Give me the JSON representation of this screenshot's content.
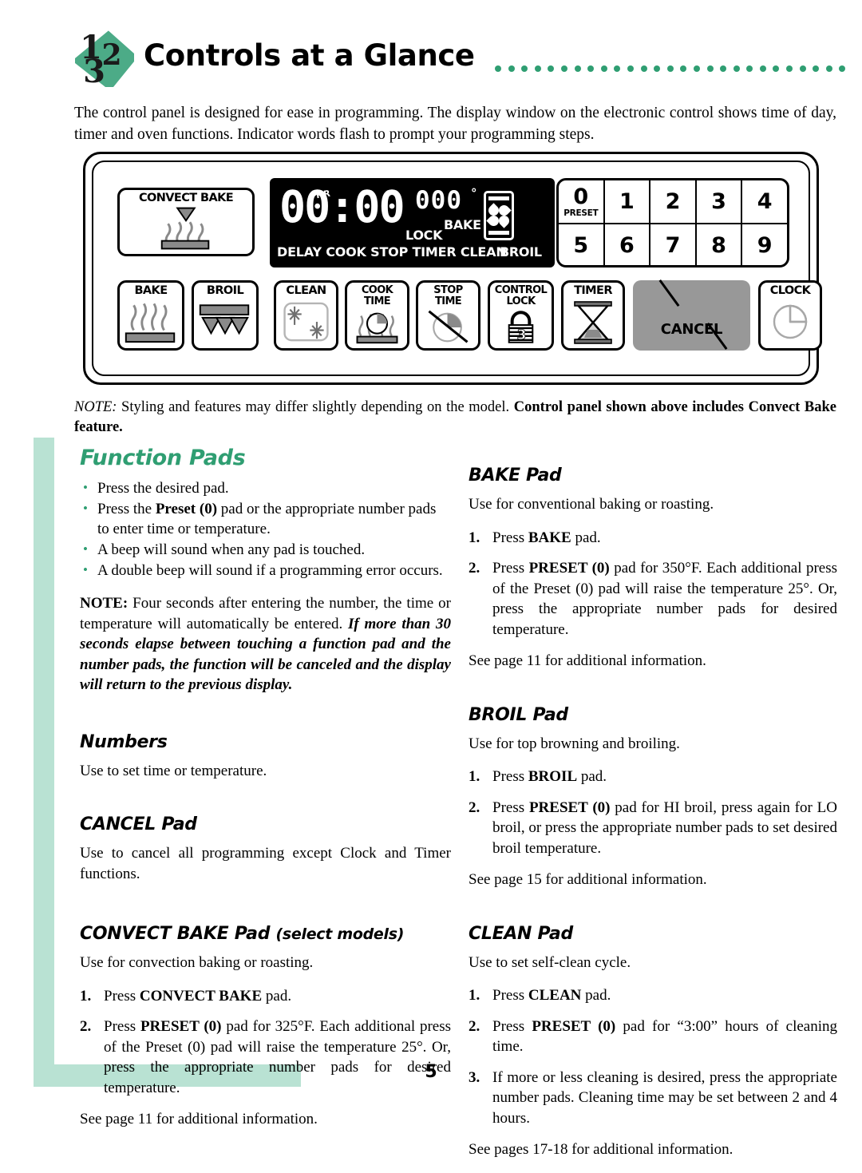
{
  "header": {
    "logo_numbers": [
      "1",
      "2",
      "3"
    ],
    "title": "Controls at a Glance",
    "dot_count": 27
  },
  "intro": "The control panel is designed for ease in programming. The display window on the electronic control shows time of day, timer and oven functions. Indicator words flash to prompt your programming steps.",
  "control_panel": {
    "convect_bake_pad": "CONVECT BAKE",
    "display": {
      "time": "00:00",
      "hr_indicator": "HR",
      "temperature": "000",
      "degree_symbol": "°",
      "lock_indicator": "LOCK",
      "bake_indicator": "BAKE",
      "broil_indicator": "BROIL",
      "status_words": "DELAY COOK STOP TIMER CLEAN",
      "fan_icon": "convection-fan-icon"
    },
    "keypad": {
      "row1": [
        {
          "num": "0",
          "sub": "PRESET"
        },
        {
          "num": "1",
          "sub": ""
        },
        {
          "num": "2",
          "sub": ""
        },
        {
          "num": "3",
          "sub": ""
        },
        {
          "num": "4",
          "sub": ""
        }
      ],
      "row2": [
        {
          "num": "5",
          "sub": ""
        },
        {
          "num": "6",
          "sub": ""
        },
        {
          "num": "7",
          "sub": ""
        },
        {
          "num": "8",
          "sub": ""
        },
        {
          "num": "9",
          "sub": ""
        }
      ]
    },
    "function_pads": {
      "bake": "BAKE",
      "broil": "BROIL",
      "clean": "CLEAN",
      "cook_time_line1": "COOK",
      "cook_time_line2": "TIME",
      "stop_time_line1": "STOP",
      "stop_time_line2": "TIME",
      "control_lock_line1": "CONTROL",
      "control_lock_line2": "LOCK",
      "control_lock_digit": "3",
      "timer": "TIMER",
      "cancel": "CANCEL",
      "clock": "CLOCK"
    },
    "cancel_pad_color": "#989898"
  },
  "panel_note": {
    "label": "NOTE:",
    "text_regular": " Styling and features may differ slightly depending on the model. ",
    "text_bold": "Control panel shown above includes Convect Bake feature."
  },
  "left_column": {
    "heading": "Function Pads",
    "bullets": [
      "Press the desired pad.",
      "Press the Preset (0) pad or the appropriate number pads to enter time or temperature.",
      "A beep will sound when any pad is touched.",
      "A double beep will sound if a programming error occurs."
    ],
    "note_label": "NOTE:",
    "note_regular": " Four seconds after entering the number, the time or temperature will automatically be entered. ",
    "note_italic": "If more than 30 seconds elapse between touching a function pad and the number pads, the function will be canceled and the display will return to the previous display.",
    "numbers": {
      "heading": "Numbers",
      "body": "Use to set time or temperature."
    },
    "cancel": {
      "heading": "CANCEL Pad",
      "body": "Use to cancel all programming except Clock and Timer functions."
    },
    "convect_bake": {
      "heading": "CONVECT BAKE Pad",
      "heading_suffix": "(select models)",
      "body": "Use for convection baking or roasting.",
      "steps": [
        {
          "num": "1.",
          "bold": "CONVECT BAKE",
          "pre": "Press ",
          "post": " pad."
        },
        {
          "num": "2.",
          "bold": "PRESET (0)",
          "pre": "Press ",
          "post": " pad for 325°F. Each additional press of the Preset (0) pad will raise the temperature 25°. Or, press the appropriate number pads for desired temperature."
        }
      ],
      "see_also": "See page 11 for additional information."
    }
  },
  "right_column": {
    "bake": {
      "heading": "BAKE Pad",
      "body": "Use for conventional baking or roasting.",
      "steps": [
        {
          "num": "1.",
          "pre": "Press ",
          "bold": "BAKE",
          "post": " pad."
        },
        {
          "num": "2.",
          "pre": "Press ",
          "bold": "PRESET (0)",
          "post": " pad for 350°F. Each additional press of the Preset (0) pad will raise the temperature 25°. Or, press the appropriate number pads for desired temperature."
        }
      ],
      "see_also": "See page 11 for additional information."
    },
    "broil": {
      "heading": "BROIL Pad",
      "body": "Use for top browning and broiling.",
      "steps": [
        {
          "num": "1.",
          "pre": "Press ",
          "bold": "BROIL",
          "post": " pad."
        },
        {
          "num": "2.",
          "pre": "Press ",
          "bold": "PRESET (0)",
          "post": " pad for HI broil, press again for LO broil, or press the appropriate number pads to set desired broil temperature."
        }
      ],
      "see_also": "See page 15 for additional information."
    },
    "clean": {
      "heading": "CLEAN Pad",
      "body": "Use to set self-clean cycle.",
      "steps": [
        {
          "num": "1.",
          "pre": "Press ",
          "bold": "CLEAN",
          "post": " pad."
        },
        {
          "num": "2.",
          "pre": "Press ",
          "bold": "PRESET (0)",
          "post": " pad for “3:00” hours of cleaning time."
        },
        {
          "num": "3.",
          "pre": "",
          "bold": "",
          "post": "If more or less cleaning is desired, press the appropriate number pads. Cleaning time may be set between 2 and 4 hours."
        }
      ],
      "see_also": "See pages 17-18 for additional information."
    }
  },
  "footer": {
    "page_number": "5"
  },
  "colors": {
    "accent_green": "#2f9e72",
    "mint": "#b9e2d3",
    "cancel_gray": "#989898",
    "element_gray": "#8a8a8a"
  }
}
